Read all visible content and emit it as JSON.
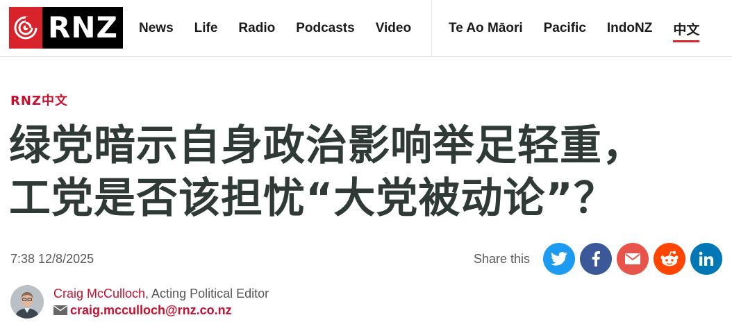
{
  "header": {
    "logo_text": "RNZ",
    "nav_main": [
      {
        "label": "News"
      },
      {
        "label": "Life"
      },
      {
        "label": "Radio"
      },
      {
        "label": "Podcasts"
      },
      {
        "label": "Video"
      }
    ],
    "nav_lang": [
      {
        "label": "Te Ao Māori",
        "active": false
      },
      {
        "label": "Pacific",
        "active": false
      },
      {
        "label": "IndoNZ",
        "active": false
      },
      {
        "label": "中文",
        "active": true
      }
    ],
    "accent_color": "#d8232a"
  },
  "article": {
    "section": "RNZ中文",
    "headline_line1": "绿党暗示自身政治影响举足轻重，",
    "headline_line2": "工党是否该担忧“大党被动论”？",
    "timestamp": "7:38 12/8/2025",
    "share_label": "Share this",
    "share_buttons": [
      {
        "icon": "twitter-icon",
        "color": "#1d9bf0"
      },
      {
        "icon": "facebook-icon",
        "color": "#3b5998"
      },
      {
        "icon": "mail-icon",
        "color": "#e8534a"
      },
      {
        "icon": "reddit-icon",
        "color": "#ff4500"
      },
      {
        "icon": "linkedin-icon",
        "color": "#0077b5"
      }
    ],
    "author": {
      "name": "Craig McCulloch",
      "role": ", Acting Political Editor",
      "email": "craig.mcculloch@rnz.co.nz"
    }
  }
}
